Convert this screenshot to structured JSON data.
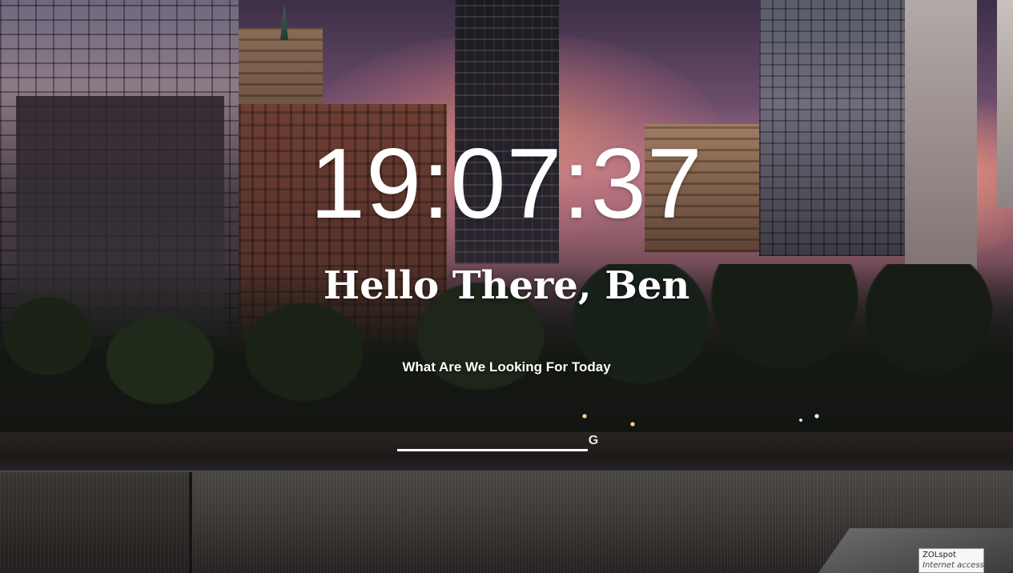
{
  "clock": {
    "time": "19:07:37"
  },
  "greeting": {
    "text": "Hello There, Ben"
  },
  "search": {
    "prompt": "What Are We Looking For Today",
    "value": "",
    "placeholder": "",
    "icon": "search-icon"
  },
  "network_tooltip": {
    "name": "ZOLspot",
    "status": "Internet access"
  }
}
